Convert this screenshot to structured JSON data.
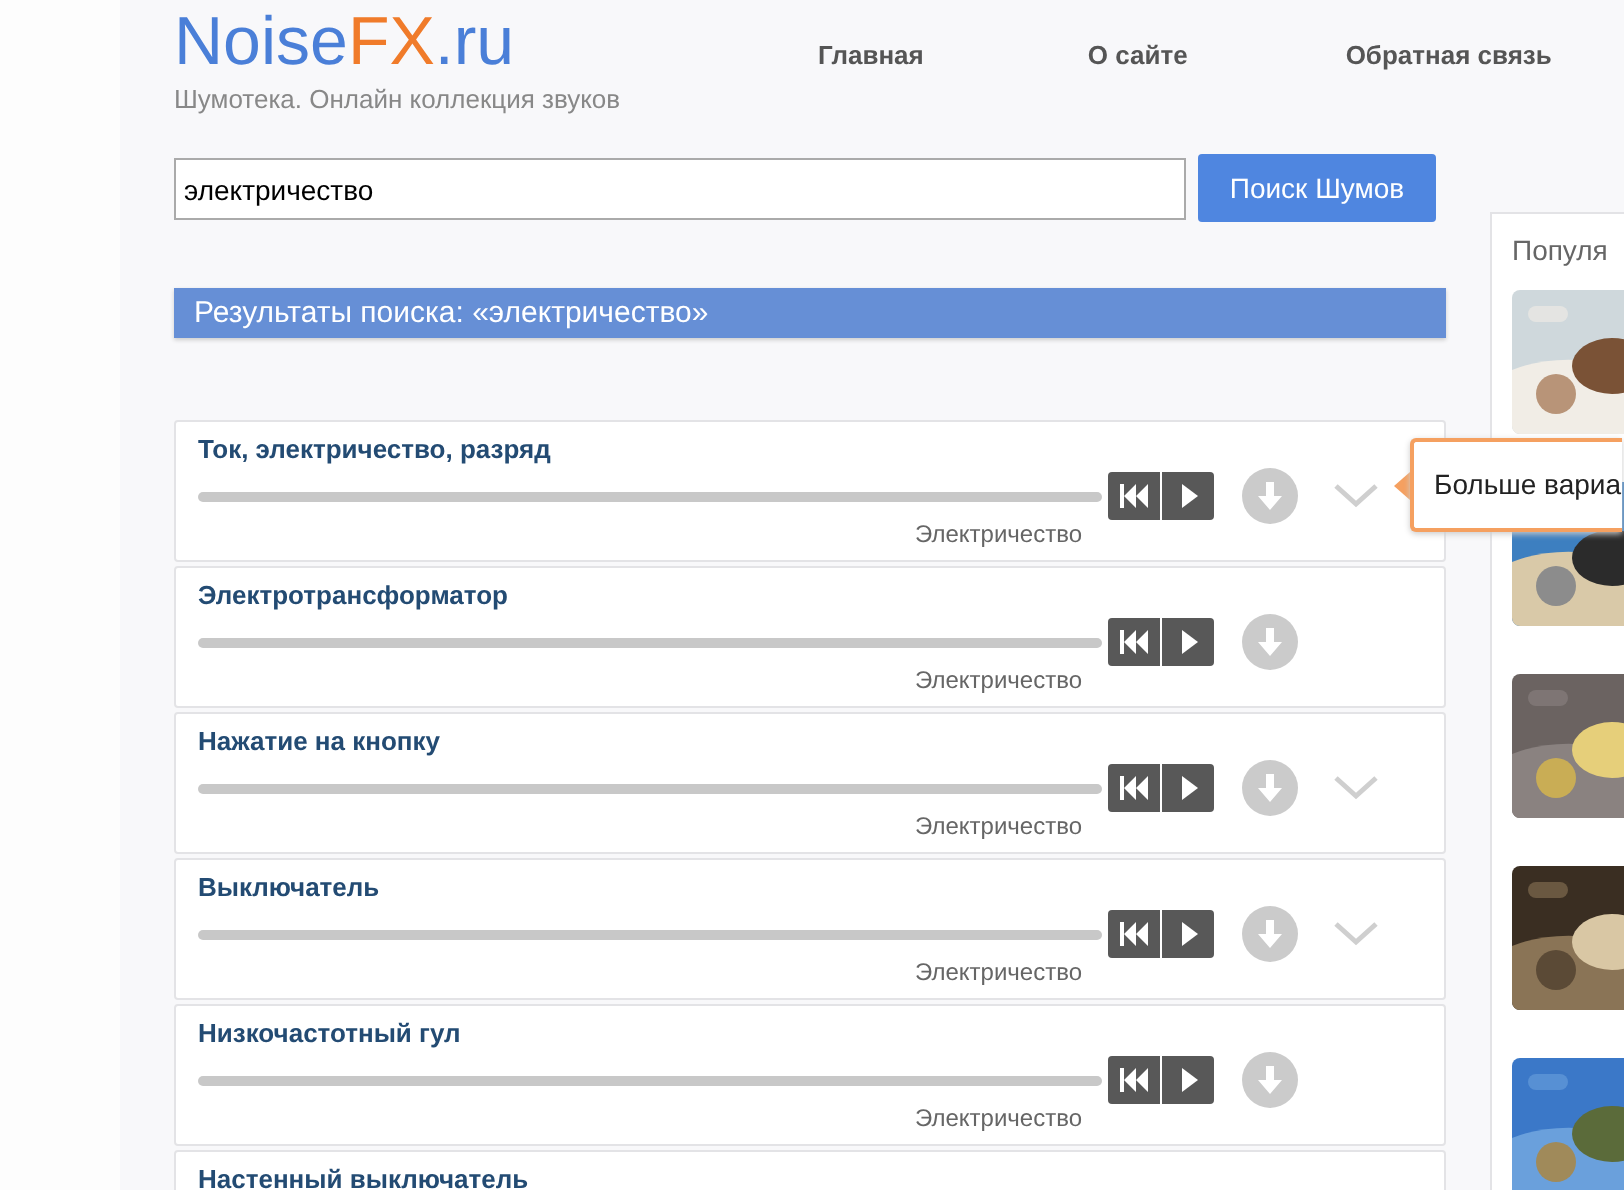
{
  "logo": {
    "parts": [
      {
        "text": "Noise",
        "color": "#4a7fd8"
      },
      {
        "text": "FX",
        "color": "#f07b2a"
      },
      {
        "text": ".ru",
        "color": "#4a7fd8"
      }
    ],
    "tagline": "Шумотека. Онлайн коллекция звуков"
  },
  "nav": [
    "Главная",
    "О сайте",
    "Обратная связь"
  ],
  "search": {
    "value": "электричество",
    "button": "Поиск Шумов"
  },
  "results_title": "Результаты поиска: «электричество»",
  "sounds": [
    {
      "title": "Ток, электричество, разряд",
      "category": "Электричество",
      "has_more": true
    },
    {
      "title": "Электротрансформатор",
      "category": "Электричество",
      "has_more": false
    },
    {
      "title": "Нажатие на кнопку",
      "category": "Электричество",
      "has_more": true
    },
    {
      "title": "Выключатель",
      "category": "Электричество",
      "has_more": true
    },
    {
      "title": "Низкочастотный гул",
      "category": "Электричество",
      "has_more": false
    },
    {
      "title": "Настенный выключатель"
    }
  ],
  "tooltip": "Больше вариа",
  "sidebar": {
    "title": "Популя"
  }
}
